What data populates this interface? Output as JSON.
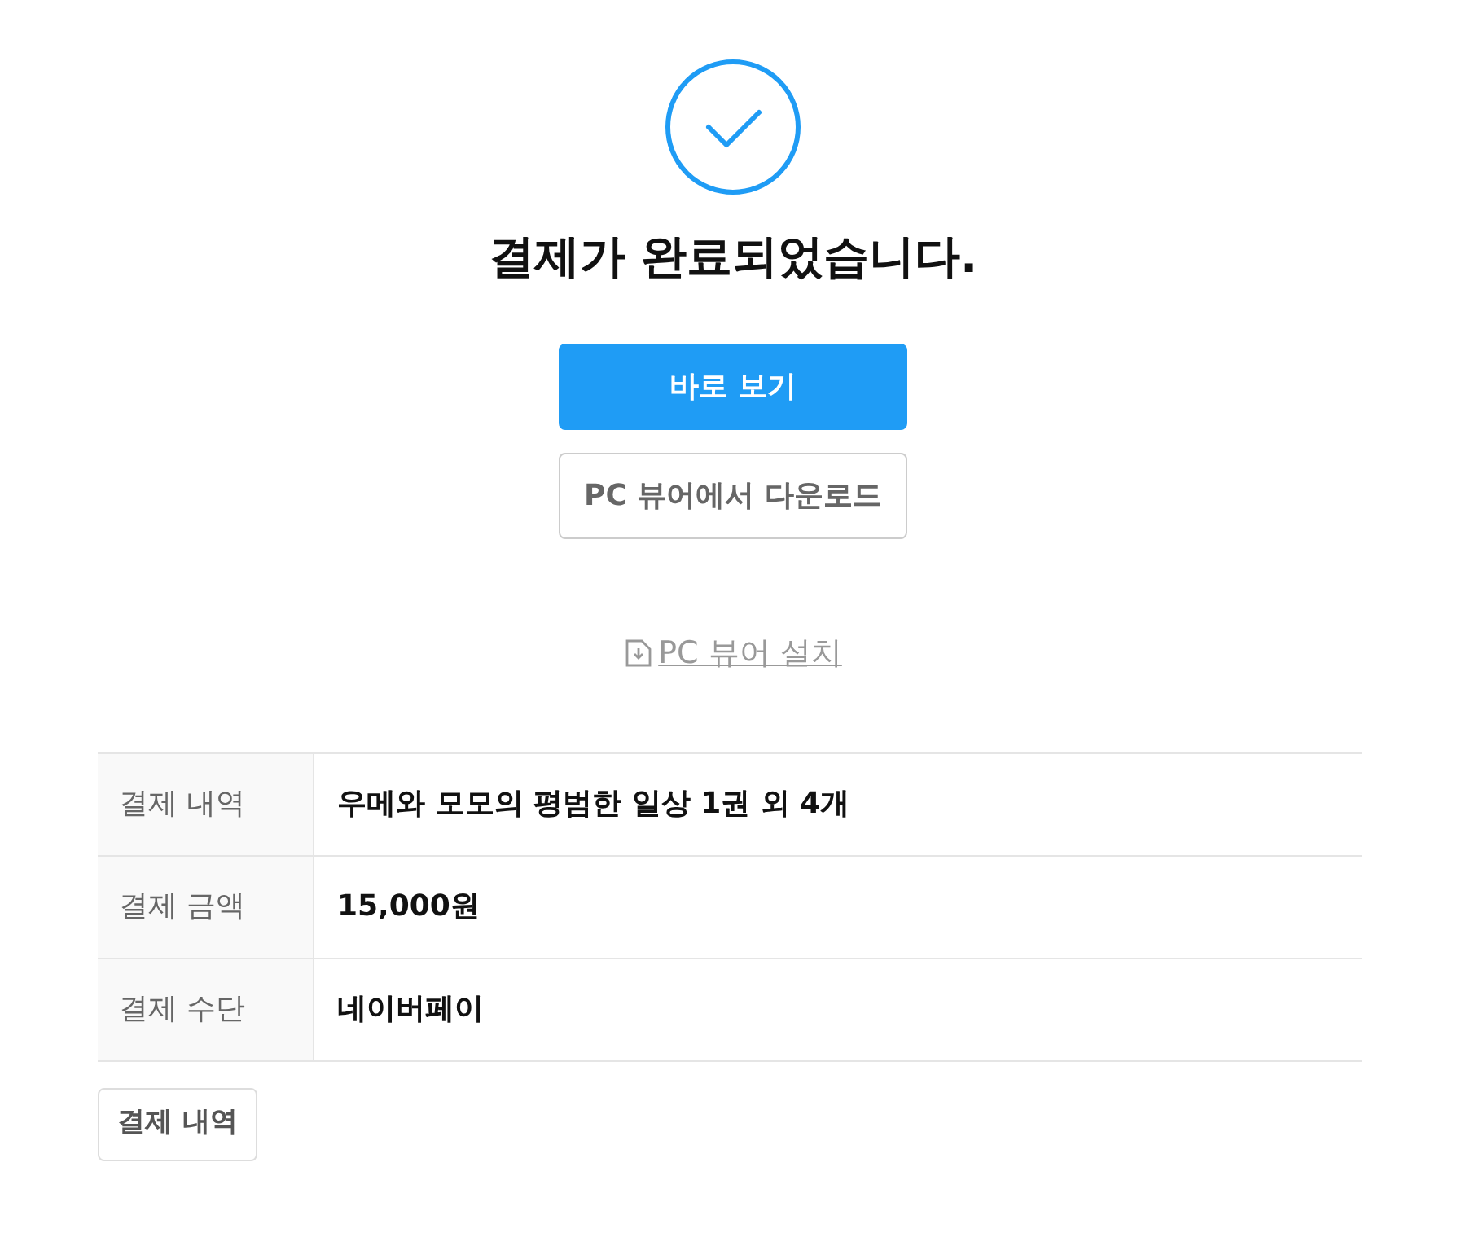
{
  "title": "결제가 완료되었습니다.",
  "buttons": [
    {
      "label": "바로 보기",
      "kind": "primary"
    },
    {
      "label": "PC 뷰어에서 다운로드",
      "kind": "secondary"
    }
  ],
  "install_link": "PC 뷰어 설치",
  "details": [
    {
      "label": "결제 내역",
      "value": "우메와 모모의 평범한 일상 1권 외 4개"
    },
    {
      "label": "결제 금액",
      "value": "15,000원"
    },
    {
      "label": "결제 수단",
      "value": "네이버페이"
    }
  ],
  "footer_button": "결제 내역"
}
